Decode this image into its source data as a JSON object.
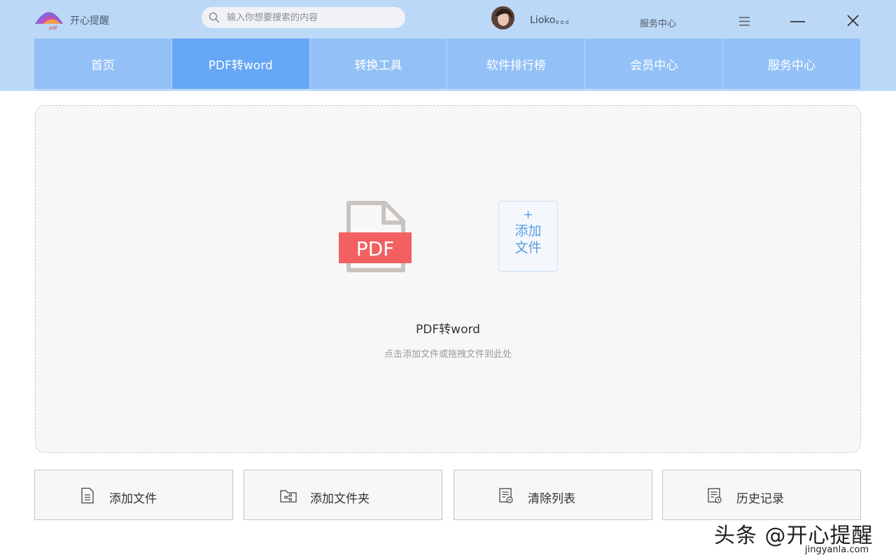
{
  "app": {
    "name": "开心提醒",
    "logo_text": "pdf"
  },
  "search": {
    "placeholder": "输入你想要搜索的内容",
    "value": ""
  },
  "user": {
    "name": "Lioko。。。"
  },
  "header": {
    "service_center": "服务中心"
  },
  "nav": {
    "items": [
      {
        "label": "首页",
        "active": false
      },
      {
        "label": "PDF转word",
        "active": true
      },
      {
        "label": "转换工具",
        "active": false
      },
      {
        "label": "软件排行榜",
        "active": false
      },
      {
        "label": "会员中心",
        "active": false
      },
      {
        "label": "服务中心",
        "active": false
      }
    ]
  },
  "dropzone": {
    "file_badge": "PDF",
    "add_plus": "+",
    "add_label": "添加文件",
    "title": "PDF转word",
    "hint": "点击添加文件或拖拽文件到此处"
  },
  "actions": [
    {
      "label": "添加文件",
      "icon": "document-icon"
    },
    {
      "label": "添加文件夹",
      "icon": "folder-share-icon"
    },
    {
      "label": "清除列表",
      "icon": "clear-list-icon"
    },
    {
      "label": "历史记录",
      "icon": "history-icon"
    }
  ],
  "watermark": {
    "text": "头条 @开心提醒",
    "url": "jingyanla.com"
  },
  "colors": {
    "header_bg": "#bcd8f7",
    "nav_bg": "#93c1f7",
    "nav_active": "#65a6f6",
    "pdf_red": "#f26061",
    "accent_blue": "#5a9be2"
  }
}
